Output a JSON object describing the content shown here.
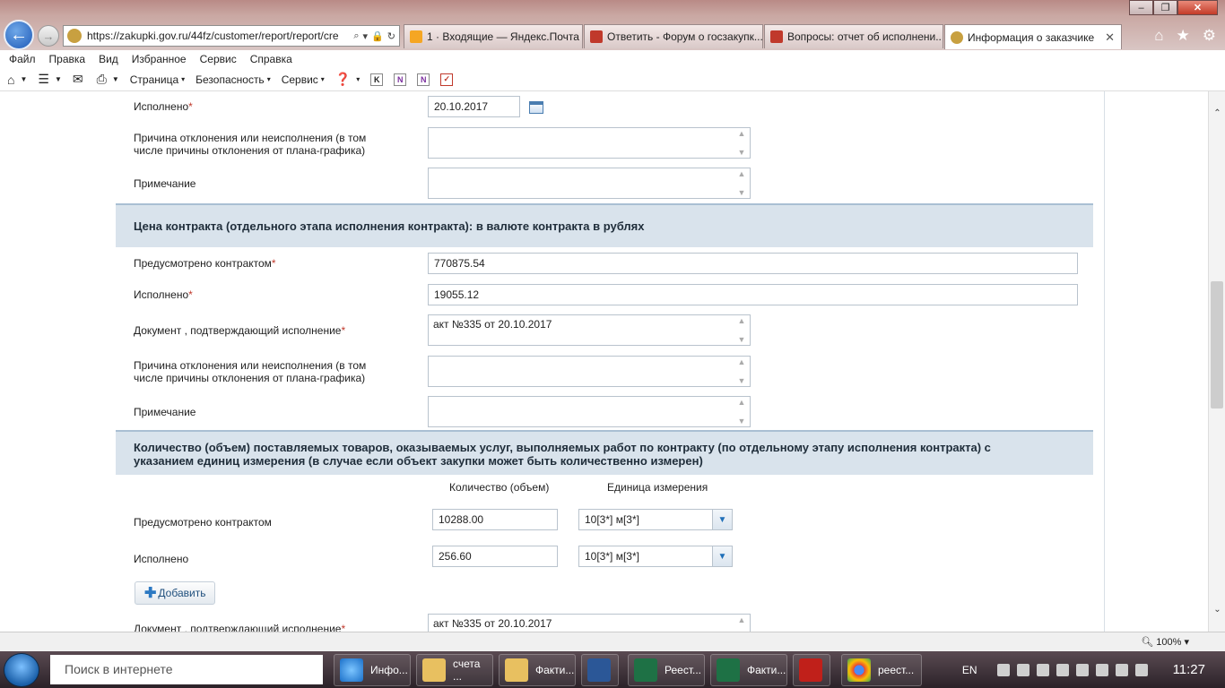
{
  "browser": {
    "url": "https://zakupki.gov.ru/44fz/customer/report/report/cre",
    "tabs": [
      {
        "label": "1 · Входящие — Яндекс.Почта",
        "active": false
      },
      {
        "label": "Ответить - Форум о госзакупк...",
        "active": false
      },
      {
        "label": "Вопросы: отчет об исполнени...",
        "active": false
      },
      {
        "label": "Информация о заказчике",
        "active": true
      }
    ],
    "menu": [
      "Файл",
      "Правка",
      "Вид",
      "Избранное",
      "Сервис",
      "Справка"
    ],
    "commands": {
      "page": "Страница",
      "security": "Безопасность",
      "service": "Сервис"
    }
  },
  "form": {
    "row_executed_date": {
      "label": "Исполнено",
      "value": "20.10.2017"
    },
    "row_reason_1": {
      "label_line1": "Причина отклонения или неисполнения (в том",
      "label_line2": "числе причины отклонения от плана-графика)",
      "value": ""
    },
    "row_note_1": {
      "label": "Примечание",
      "value": ""
    },
    "section_price": {
      "title": "Цена контракта (отдельного этапа исполнения контракта): в валюте контракта в рублях"
    },
    "row_price_planned": {
      "label": "Предусмотрено контрактом",
      "value": "770875.54"
    },
    "row_price_executed": {
      "label": "Исполнено",
      "value": "19055.12"
    },
    "row_doc_1": {
      "label": "Документ , подтверждающий исполнение",
      "value": "акт №335 от 20.10.2017"
    },
    "row_reason_2": {
      "label_line1": "Причина отклонения или неисполнения (в том",
      "label_line2": "числе причины отклонения от плана-графика)",
      "value": ""
    },
    "row_note_2": {
      "label": "Примечание",
      "value": ""
    },
    "section_qty": {
      "title_line1": "Количество (объем) поставляемых товаров, оказываемых услуг, выполняемых работ по контракту (по отдельному этапу исполнения контракта) с",
      "title_line2": "указанием единиц измерения (в случае если объект закупки может быть количественно измерен)"
    },
    "qty_headers": {
      "quantity": "Количество (объем)",
      "unit": "Единица измерения"
    },
    "row_qty_planned": {
      "label": "Предусмотрено контрактом",
      "quantity": "10288.00",
      "unit": "10[3*] м[3*]"
    },
    "row_qty_executed": {
      "label": "Исполнено",
      "quantity": "256.60",
      "unit": "10[3*] м[3*]"
    },
    "add_button": "Добавить",
    "row_doc_2": {
      "label": "Документ , подтверждающий исполнение",
      "value": "акт №335 от 20.10.2017"
    }
  },
  "status": {
    "zoom": "100%"
  },
  "taskbar": {
    "search_placeholder": "Поиск в интернете",
    "items": [
      {
        "label": "Инфо...",
        "icon": "ie-icon"
      },
      {
        "label": "счета ...",
        "icon": "folder-icon"
      },
      {
        "label": "Факти...",
        "icon": "folder-icon"
      },
      {
        "label": "",
        "icon": "word-icon"
      },
      {
        "label": "Реест...",
        "icon": "excel-icon"
      },
      {
        "label": "Факти...",
        "icon": "excel-icon"
      },
      {
        "label": "",
        "icon": "acrobat-icon"
      },
      {
        "label": "реест...",
        "icon": "chrome-icon"
      }
    ],
    "lang": "EN",
    "clock": "11:27"
  }
}
